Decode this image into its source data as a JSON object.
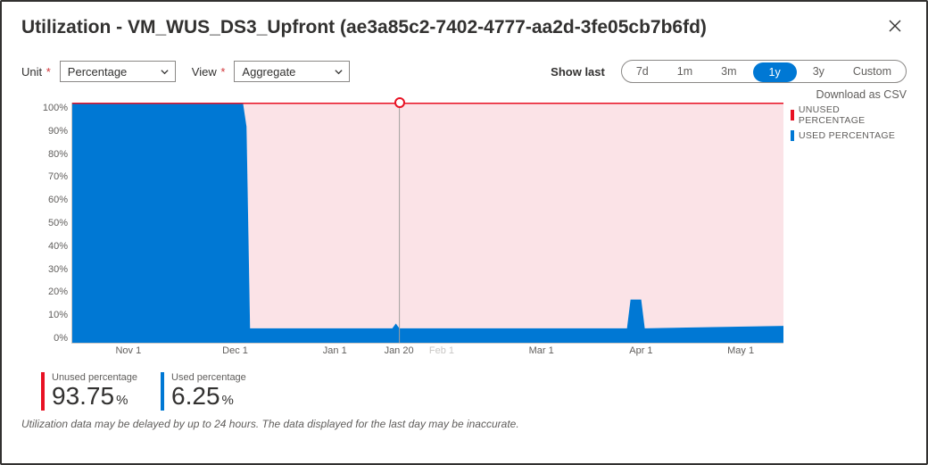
{
  "header": {
    "title": "Utilization - VM_WUS_DS3_Upfront (ae3a85c2-7402-4777-aa2d-3fe05cb7b6fd)"
  },
  "controls": {
    "unit_label": "Unit",
    "unit_value": "Percentage",
    "view_label": "View",
    "view_value": "Aggregate",
    "showlast_label": "Show last",
    "range_options": [
      "7d",
      "1m",
      "3m",
      "1y",
      "3y",
      "Custom"
    ],
    "range_selected": "1y",
    "download_label": "Download as CSV"
  },
  "legend": {
    "unused": "UNUSED PERCENTAGE",
    "used": "USED PERCENTAGE"
  },
  "stats": {
    "unused_label": "Unused percentage",
    "unused_value": "93.75",
    "used_label": "Used percentage",
    "used_value": "6.25",
    "pct_suffix": "%"
  },
  "footnote": "Utilization data may be delayed by up to 24 hours. The data displayed for the last day may be inaccurate.",
  "colors": {
    "used": "#0078d4",
    "unused": "#e81123",
    "unused_fill": "#fbe3e7",
    "grid": "#e1dfdd",
    "tick": "#c8c6c4"
  },
  "chart_data": {
    "type": "area",
    "ylabel": "",
    "xlabel": "",
    "ylim": [
      0,
      100
    ],
    "y_ticks": [
      "100%",
      "90%",
      "80%",
      "70%",
      "60%",
      "50%",
      "40%",
      "30%",
      "20%",
      "10%",
      "0%"
    ],
    "x_ticks": [
      {
        "label": "Nov 1",
        "pos": 0.08
      },
      {
        "label": "Dec 1",
        "pos": 0.23
      },
      {
        "label": "Jan 1",
        "pos": 0.37
      },
      {
        "label": "Jan 20",
        "pos": 0.46
      },
      {
        "label": "Feb 1",
        "pos": 0.52,
        "dim": true
      },
      {
        "label": "Mar 1",
        "pos": 0.66
      },
      {
        "label": "Apr 1",
        "pos": 0.8
      },
      {
        "label": "May 1",
        "pos": 0.94
      }
    ],
    "marker_x": 0.46,
    "series": [
      {
        "name": "UNUSED PERCENTAGE",
        "color": "#e81123",
        "fill": "#fbe3e7",
        "points": [
          {
            "x": 0.0,
            "y": 0
          },
          {
            "x": 0.24,
            "y": 0
          },
          {
            "x": 0.245,
            "y": 10
          },
          {
            "x": 0.25,
            "y": 94
          },
          {
            "x": 0.78,
            "y": 94
          },
          {
            "x": 0.785,
            "y": 82
          },
          {
            "x": 0.8,
            "y": 82
          },
          {
            "x": 0.805,
            "y": 94
          },
          {
            "x": 1.0,
            "y": 93
          }
        ]
      },
      {
        "name": "USED PERCENTAGE",
        "color": "#0078d4",
        "fill": "#0078d4",
        "points": [
          {
            "x": 0.0,
            "y": 100
          },
          {
            "x": 0.24,
            "y": 100
          },
          {
            "x": 0.245,
            "y": 90
          },
          {
            "x": 0.25,
            "y": 6
          },
          {
            "x": 0.45,
            "y": 6
          },
          {
            "x": 0.455,
            "y": 8
          },
          {
            "x": 0.46,
            "y": 6
          },
          {
            "x": 0.78,
            "y": 6
          },
          {
            "x": 0.785,
            "y": 18
          },
          {
            "x": 0.8,
            "y": 18
          },
          {
            "x": 0.805,
            "y": 6
          },
          {
            "x": 1.0,
            "y": 7
          }
        ]
      }
    ]
  }
}
